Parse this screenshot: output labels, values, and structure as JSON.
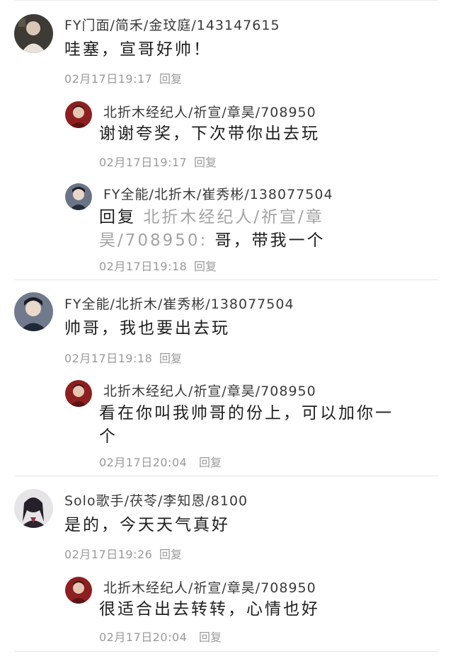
{
  "threads": [
    {
      "name": "FY门面/简禾/金玟庭/143147615",
      "text": "哇塞，宣哥好帅！",
      "time": "02月17日19:17",
      "reply_label": "回复",
      "replies": [
        {
          "name": "北折木经纪人/祈宣/章昊/708950",
          "text": "谢谢夸奖，下次带你出去玩",
          "time": "02月17日19:17",
          "reply_label": "回复"
        },
        {
          "name": "FY全能/北折木/崔秀彬/138077504",
          "reply_prefix": "回复",
          "mention": "北折木经纪人/祈宣/章昊/708950:",
          "text": "哥，带我一个",
          "time": "02月17日19:18",
          "reply_label": "回复"
        }
      ]
    },
    {
      "name": "FY全能/北折木/崔秀彬/138077504",
      "text": "帅哥，我也要出去玩",
      "time": "02月17日19:18",
      "reply_label": "回复",
      "replies": [
        {
          "name": "北折木经纪人/祈宣/章昊/708950",
          "text": "看在你叫我帅哥的份上，可以加你一个",
          "time": "02月17日20:04",
          "reply_label": "回复"
        }
      ]
    },
    {
      "name": "Solo歌手/茯苓/李知恩/8100",
      "text": "是的，今天天气真好",
      "time": "02月17日19:26",
      "reply_label": "回复",
      "replies": [
        {
          "name": "北折木经纪人/祈宣/章昊/708950",
          "text": "很适合出去转转，心情也好",
          "time": "02月17日20:04",
          "reply_label": "回复"
        }
      ]
    }
  ],
  "avatars": {
    "t1": "avatar-photo-dark",
    "reply_manager": "avatar-photo-red",
    "t2": "avatar-photo-blue",
    "t3": "avatar-photo-light"
  }
}
